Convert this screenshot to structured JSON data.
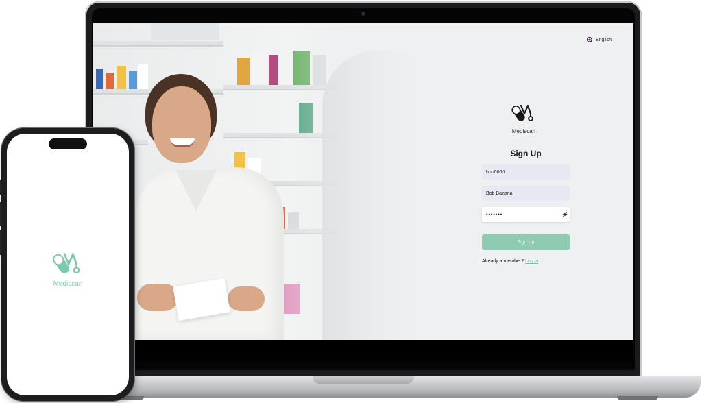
{
  "laptop_app": {
    "language": "English",
    "brand_name": "Mediscan",
    "title": "Sign Up",
    "username_value": "bob0000",
    "fullname_value": "Bob Banana",
    "password_value": "•••••••",
    "signup_button": "Sign Up",
    "member_text": "Already a member?",
    "login_link": "Log in"
  },
  "phone_app": {
    "brand_name": "Mediscan"
  },
  "colors": {
    "accent": "#8fcbb3",
    "brand_dark": "#1a1a1a",
    "brand_light": "#7ec8ac",
    "field_bg": "#e6e9f2"
  },
  "icons": [
    "globe-flag-icon",
    "mediscan-logo-icon",
    "eye-off-icon"
  ]
}
